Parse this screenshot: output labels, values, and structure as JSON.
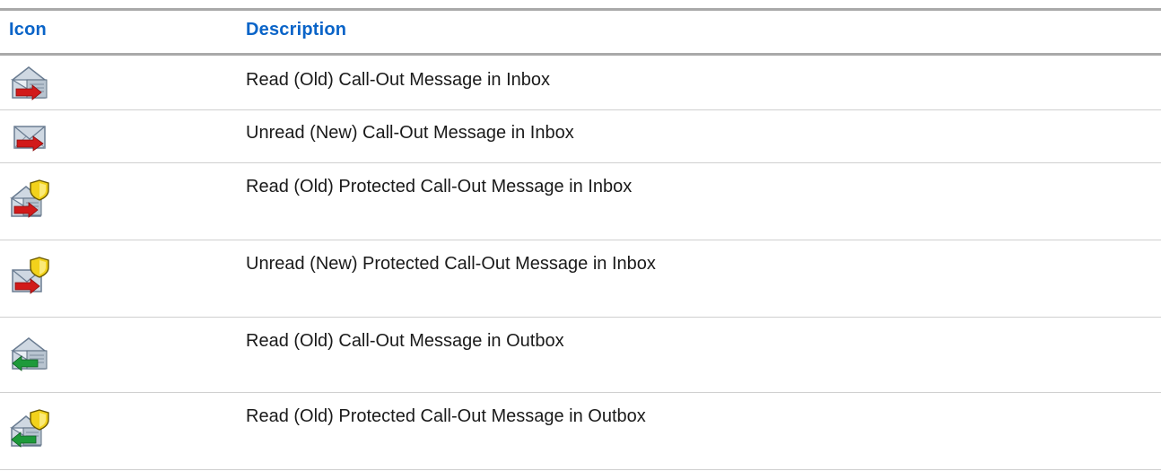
{
  "table": {
    "headers": {
      "icon": "Icon",
      "description": "Description"
    },
    "rows": [
      {
        "icon": "read-callout-inbox-icon",
        "description": "Read (Old) Call-Out Message in Inbox"
      },
      {
        "icon": "unread-callout-inbox-icon",
        "description": "Unread (New) Call-Out Message in Inbox"
      },
      {
        "icon": "read-protected-callout-inbox-icon",
        "description": "Read (Old) Protected Call-Out Message in Inbox"
      },
      {
        "icon": "unread-protected-callout-inbox-icon",
        "description": "Unread (New) Protected Call-Out Message in Inbox"
      },
      {
        "icon": "read-callout-outbox-icon",
        "description": "Read (Old) Call-Out Message in Outbox"
      },
      {
        "icon": "read-protected-callout-outbox-icon",
        "description": "Read (Old) Protected Call-Out Message in Outbox"
      }
    ]
  },
  "colors": {
    "header_text": "#0a64c8",
    "rule": "#a9a9a9",
    "row_border": "#d0d0d0",
    "inbox_arrow": "#d11a1a",
    "outbox_arrow": "#1e9a3a",
    "shield": "#f2d21b"
  }
}
